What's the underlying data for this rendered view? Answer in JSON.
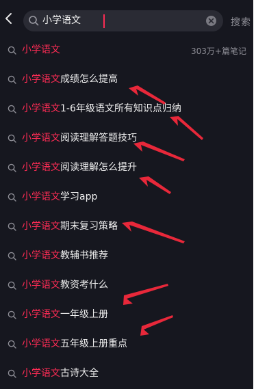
{
  "search": {
    "query": "小学语文",
    "action_label": "搜索"
  },
  "suggestions": [
    {
      "highlight": "小学语文",
      "rest": "",
      "count": "303万+篇笔记"
    },
    {
      "highlight": "小学语文",
      "rest": "成绩怎么提高"
    },
    {
      "highlight": "小学语文",
      "rest": "1-6年级语文所有知识点归纳"
    },
    {
      "highlight": "小学语文",
      "rest": "阅读理解答题技巧"
    },
    {
      "highlight": "小学语文",
      "rest": "阅读理解怎么提升"
    },
    {
      "highlight": "小学语文",
      "rest": "学习app"
    },
    {
      "highlight": "小学语文",
      "rest": "期末复习策略"
    },
    {
      "highlight": "小学语文",
      "rest": "教辅书推荐"
    },
    {
      "highlight": "小学语文",
      "rest": "教资考什么"
    },
    {
      "highlight": "小学语文",
      "rest": "一年级上册"
    },
    {
      "highlight": "小学语文",
      "rest": "五年级上册重点"
    },
    {
      "highlight": "小学语文",
      "rest": "古诗大全"
    }
  ],
  "colors": {
    "background": "#16171f",
    "highlight": "#fe2c55",
    "annotation_arrow": "#e8283a"
  }
}
